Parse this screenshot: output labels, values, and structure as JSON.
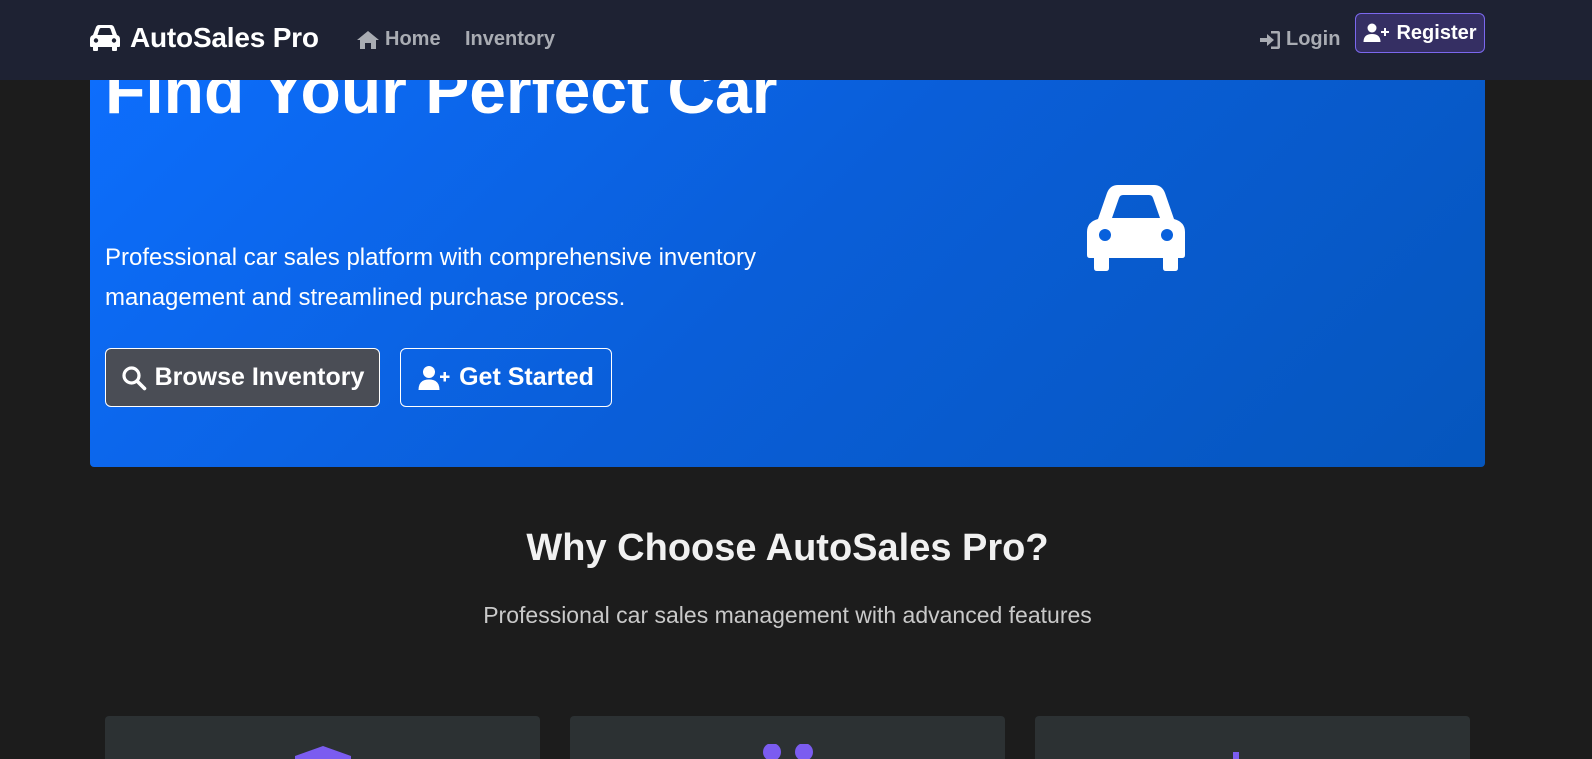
{
  "navbar": {
    "brand": "AutoSales Pro",
    "brand_icon": "car-icon",
    "links": {
      "home": "Home",
      "inventory": "Inventory",
      "login": "Login"
    },
    "register": "Register"
  },
  "hero": {
    "title": "Find Your Perfect Car",
    "subtitle": "Professional car sales platform with comprehensive inventory management and streamlined purchase process.",
    "buttons": {
      "browse": "Browse Inventory",
      "start": "Get Started"
    },
    "illustration": "car-icon"
  },
  "features": {
    "title": "Why Choose AutoSales Pro?",
    "subtitle": "Professional car sales management with advanced features",
    "cards": [
      {
        "icon": "shield-icon"
      },
      {
        "icon": "users-icon"
      },
      {
        "icon": "chart-icon"
      }
    ]
  },
  "colors": {
    "navbar_bg": "#1e2233",
    "page_bg": "#1c1c1c",
    "hero_bg": "#0d6efd",
    "accent": "#7b68ee",
    "card_bg": "#2c3133"
  }
}
